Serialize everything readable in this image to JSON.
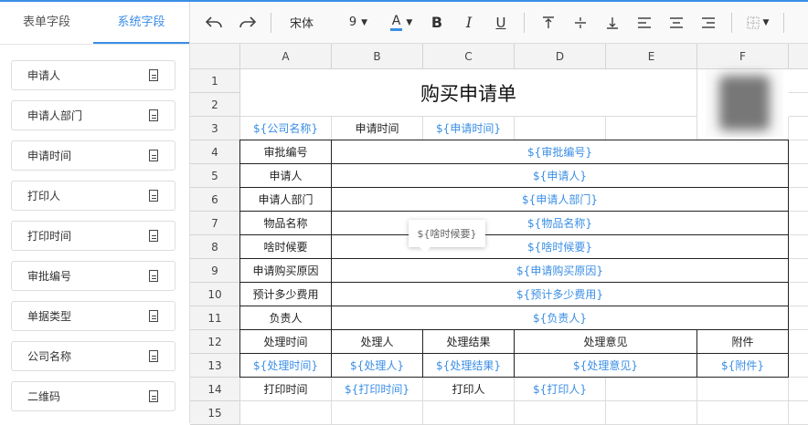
{
  "left_panel": {
    "tabs": [
      "表单字段",
      "系统字段"
    ],
    "active_tab": 1,
    "items": [
      "申请人",
      "申请人部门",
      "申请时间",
      "打印人",
      "打印时间",
      "审批编号",
      "单据类型",
      "公司名称",
      "二维码"
    ]
  },
  "toolbar": {
    "font": "宋体",
    "font_size": "9",
    "font_color_label": "A",
    "bold": "B",
    "italic": "I",
    "underline": "U",
    "accent": "#3a8ee6"
  },
  "sheet": {
    "columns": [
      "A",
      "B",
      "C",
      "D",
      "E",
      "F"
    ],
    "rows": [
      "1",
      "2",
      "3",
      "4",
      "5",
      "6",
      "7",
      "8",
      "9",
      "10",
      "11",
      "12",
      "13",
      "14",
      "15"
    ],
    "cells": [
      {
        "r": 0,
        "c": 0,
        "rs": 2,
        "cs": 5,
        "t": "购买申请单",
        "k": "title"
      },
      {
        "r": 2,
        "c": 0,
        "t": "${公司名称}",
        "k": "var"
      },
      {
        "r": 2,
        "c": 1,
        "t": "申请时间"
      },
      {
        "r": 2,
        "c": 2,
        "t": "${申请时间}",
        "k": "var"
      },
      {
        "r": 2,
        "c": 3,
        "t": ""
      },
      {
        "r": 2,
        "c": 4,
        "t": ""
      },
      {
        "r": 3,
        "c": 0,
        "t": "审批编号",
        "k": "bd"
      },
      {
        "r": 3,
        "c": 1,
        "cs": 5,
        "t": "${审批编号}",
        "k": "var bd"
      },
      {
        "r": 4,
        "c": 0,
        "t": "申请人",
        "k": "bd"
      },
      {
        "r": 4,
        "c": 1,
        "cs": 5,
        "t": "${申请人}",
        "k": "var bd"
      },
      {
        "r": 5,
        "c": 0,
        "t": "申请人部门",
        "k": "bd"
      },
      {
        "r": 5,
        "c": 1,
        "cs": 5,
        "t": "${申请人部门}",
        "k": "var bd"
      },
      {
        "r": 6,
        "c": 0,
        "t": "物品名称",
        "k": "bd"
      },
      {
        "r": 6,
        "c": 1,
        "cs": 5,
        "t": "${物品名称}",
        "k": "var bd"
      },
      {
        "r": 7,
        "c": 0,
        "t": "啥时候要",
        "k": "bd"
      },
      {
        "r": 7,
        "c": 1,
        "cs": 5,
        "t": "${啥时候要}",
        "k": "var bd"
      },
      {
        "r": 8,
        "c": 0,
        "t": "申请购买原因",
        "k": "bd"
      },
      {
        "r": 8,
        "c": 1,
        "cs": 5,
        "t": "${申请购买原因}",
        "k": "var bd"
      },
      {
        "r": 9,
        "c": 0,
        "t": "预计多少费用",
        "k": "bd"
      },
      {
        "r": 9,
        "c": 1,
        "cs": 5,
        "t": "${预计多少费用}",
        "k": "var bd"
      },
      {
        "r": 10,
        "c": 0,
        "t": "负责人",
        "k": "bd"
      },
      {
        "r": 10,
        "c": 1,
        "cs": 5,
        "t": "${负责人}",
        "k": "var bd"
      },
      {
        "r": 11,
        "c": 0,
        "t": "处理时间",
        "k": "bd"
      },
      {
        "r": 11,
        "c": 1,
        "t": "处理人",
        "k": "bd"
      },
      {
        "r": 11,
        "c": 2,
        "t": "处理结果",
        "k": "bd"
      },
      {
        "r": 11,
        "c": 3,
        "cs": 2,
        "t": "处理意见",
        "k": "bd"
      },
      {
        "r": 11,
        "c": 5,
        "t": "附件",
        "k": "bd"
      },
      {
        "r": 12,
        "c": 0,
        "t": "${处理时间}",
        "k": "var bd"
      },
      {
        "r": 12,
        "c": 1,
        "t": "${处理人}",
        "k": "var bd"
      },
      {
        "r": 12,
        "c": 2,
        "t": "${处理结果}",
        "k": "var bd"
      },
      {
        "r": 12,
        "c": 3,
        "cs": 2,
        "t": "${处理意见}",
        "k": "var bd"
      },
      {
        "r": 12,
        "c": 5,
        "t": "${附件}",
        "k": "var bd"
      },
      {
        "r": 13,
        "c": 0,
        "t": "打印时间"
      },
      {
        "r": 13,
        "c": 1,
        "t": "${打印时间}",
        "k": "var"
      },
      {
        "r": 13,
        "c": 2,
        "t": "打印人"
      },
      {
        "r": 13,
        "c": 3,
        "t": "${打印人}",
        "k": "var"
      },
      {
        "r": 13,
        "c": 4,
        "t": ""
      },
      {
        "r": 13,
        "c": 5,
        "t": ""
      },
      {
        "r": 14,
        "c": 0,
        "t": ""
      },
      {
        "r": 14,
        "c": 1,
        "t": ""
      },
      {
        "r": 14,
        "c": 2,
        "t": ""
      },
      {
        "r": 14,
        "c": 3,
        "t": ""
      },
      {
        "r": 14,
        "c": 4,
        "t": ""
      },
      {
        "r": 14,
        "c": 5,
        "t": ""
      }
    ]
  },
  "tooltip": "${啥时候要}",
  "qr_image": "qr-code-blurred"
}
